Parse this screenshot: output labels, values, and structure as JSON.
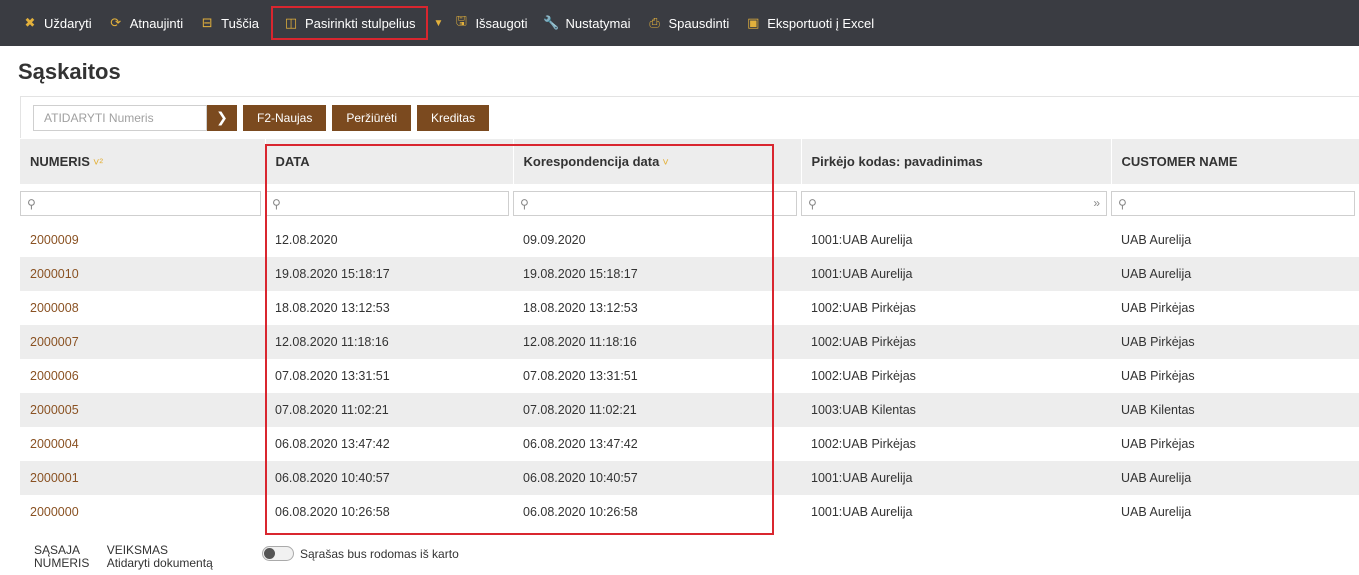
{
  "toolbar": {
    "items": [
      {
        "label": "Uždaryti",
        "icon": "close-icon"
      },
      {
        "label": "Atnaujinti",
        "icon": "refresh-icon"
      },
      {
        "label": "Tuščia",
        "icon": "blank-icon"
      },
      {
        "label": "Pasirinkti stulpelius",
        "icon": "columns-icon"
      },
      {
        "label": "Išsaugoti",
        "icon": "save-icon"
      },
      {
        "label": "Nustatymai",
        "icon": "wrench-icon"
      },
      {
        "label": "Spausdinti",
        "icon": "print-icon"
      },
      {
        "label": "Eksportuoti į Excel",
        "icon": "excel-icon"
      }
    ]
  },
  "page": {
    "title": "Sąskaitos"
  },
  "actions": {
    "open_placeholder": "ATIDARYTI Numeris",
    "new_label": "F2-Naujas",
    "view_label": "Peržiūrėti",
    "credit_label": "Kreditas"
  },
  "table": {
    "columns": [
      {
        "label": "NUMERIS",
        "sort": "˅²"
      },
      {
        "label": "DATA",
        "sort": ""
      },
      {
        "label": "Korespondencija data",
        "sort": "˅"
      },
      {
        "label": "Pirkėjo kodas: pavadinimas",
        "sort": ""
      },
      {
        "label": "CUSTOMER NAME",
        "sort": ""
      }
    ],
    "rows": [
      {
        "numeris": "2000009",
        "data": "12.08.2020",
        "kores": "09.09.2020",
        "pirkejas": "1001:UAB Aurelija",
        "customer": "UAB Aurelija"
      },
      {
        "numeris": "2000010",
        "data": "19.08.2020 15:18:17",
        "kores": "19.08.2020 15:18:17",
        "pirkejas": "1001:UAB Aurelija",
        "customer": "UAB Aurelija"
      },
      {
        "numeris": "2000008",
        "data": "18.08.2020 13:12:53",
        "kores": "18.08.2020 13:12:53",
        "pirkejas": "1002:UAB Pirkėjas",
        "customer": "UAB Pirkėjas"
      },
      {
        "numeris": "2000007",
        "data": "12.08.2020 11:18:16",
        "kores": "12.08.2020 11:18:16",
        "pirkejas": "1002:UAB Pirkėjas",
        "customer": "UAB Pirkėjas"
      },
      {
        "numeris": "2000006",
        "data": "07.08.2020 13:31:51",
        "kores": "07.08.2020 13:31:51",
        "pirkejas": "1002:UAB Pirkėjas",
        "customer": "UAB Pirkėjas"
      },
      {
        "numeris": "2000005",
        "data": "07.08.2020 11:02:21",
        "kores": "07.08.2020 11:02:21",
        "pirkejas": "1003:UAB Kilentas",
        "customer": "UAB Kilentas"
      },
      {
        "numeris": "2000004",
        "data": "06.08.2020 13:47:42",
        "kores": "06.08.2020 13:47:42",
        "pirkejas": "1002:UAB Pirkėjas",
        "customer": "UAB Pirkėjas"
      },
      {
        "numeris": "2000001",
        "data": "06.08.2020 10:40:57",
        "kores": "06.08.2020 10:40:57",
        "pirkejas": "1001:UAB Aurelija",
        "customer": "UAB Aurelija"
      },
      {
        "numeris": "2000000",
        "data": "06.08.2020 10:26:58",
        "kores": "06.08.2020 10:26:58",
        "pirkejas": "1001:UAB Aurelija",
        "customer": "UAB Aurelija"
      }
    ]
  },
  "footer": {
    "col1_line1": "SĄSAJA",
    "col1_line2": "NUMERIS",
    "col2_line1": "VEIKSMAS",
    "col2_line2": "Atidaryti dokumentą",
    "toggle_label": "Sąrašas bus rodomas iš karto"
  },
  "colors": {
    "toolbar_bg": "#3a3c42",
    "accent": "#e3b13c",
    "brand_brown": "#7b4a1f",
    "highlight_red": "#d9262f",
    "link": "#8a5223"
  }
}
